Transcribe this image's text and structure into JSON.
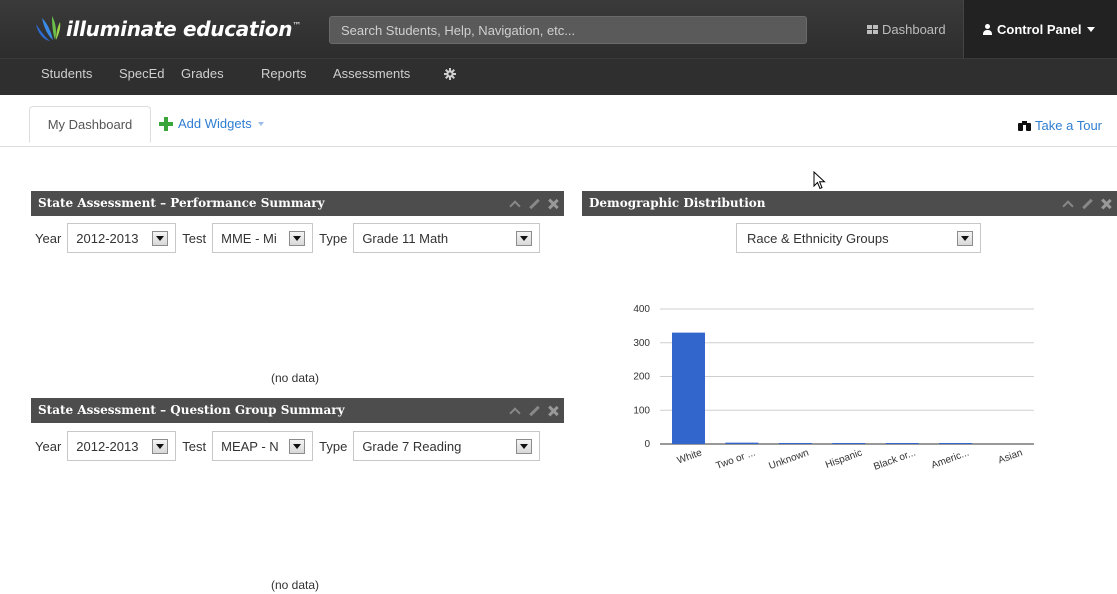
{
  "header": {
    "logo_text": "illuminate education",
    "logo_tm": "™",
    "search_placeholder": "Search Students, Help, Navigation, etc...",
    "dashboard_label": "Dashboard",
    "control_panel_label": "Control Panel"
  },
  "nav": {
    "items": [
      "Students",
      "SpecEd",
      "Grades",
      "Reports",
      "Assessments"
    ]
  },
  "tabs": {
    "my_dashboard": "My Dashboard",
    "add_widgets": "Add Widgets",
    "take_tour": "Take a Tour"
  },
  "widgets": {
    "perf_summary": {
      "title": "State Assessment – Performance Summary",
      "year_label": "Year",
      "year_value": "2012-2013",
      "test_label": "Test",
      "test_value": "MME - Mi",
      "type_label": "Type",
      "type_value": "Grade 11 Math",
      "empty_text": "(no data)"
    },
    "question_group": {
      "title": "State Assessment – Question Group Summary",
      "year_label": "Year",
      "year_value": "2012-2013",
      "test_label": "Test",
      "test_value": "MEAP - N",
      "type_label": "Type",
      "type_value": "Grade 7 Reading",
      "empty_text": "(no data)"
    },
    "demographic": {
      "title": "Demographic Distribution",
      "group_value": "Race & Ethnicity Groups"
    }
  },
  "colors": {
    "bar": "#3366cc",
    "link": "#2f7ed1",
    "widget_header": "#4d4d4d"
  },
  "chart_data": {
    "type": "bar",
    "categories": [
      "White",
      "Two or ...",
      "Unknown",
      "Hispanic",
      "Black or...",
      "Americ...",
      "Asian"
    ],
    "values": [
      330,
      4,
      3,
      2,
      1,
      1,
      0
    ],
    "ylim": [
      0,
      400
    ],
    "yticks": [
      0,
      100,
      200,
      300,
      400
    ],
    "grid": true,
    "legend": "none",
    "title": "",
    "xlabel": "",
    "ylabel": ""
  }
}
